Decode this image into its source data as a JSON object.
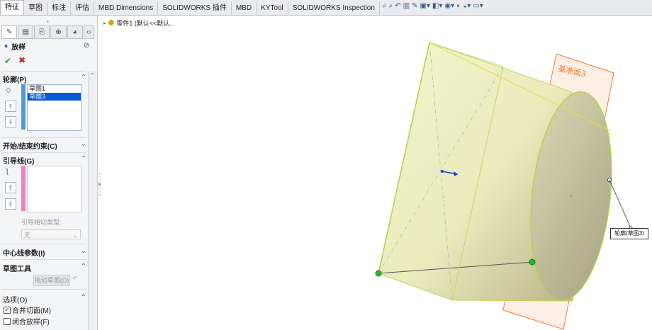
{
  "tabs": [
    "特征",
    "草图",
    "标注",
    "评估",
    "MBD Dimensions",
    "SOLIDWORKS 插件",
    "MBD",
    "KYTool",
    "SOLIDWORKS Inspection"
  ],
  "panel": {
    "feature_title": "放样",
    "sections": {
      "profiles": {
        "label": "轮廓(P)",
        "items": [
          "草图1",
          "草图3"
        ],
        "selected": "草图3"
      },
      "start_end": {
        "label": "开始/结束约束(C)"
      },
      "guides": {
        "label": "引导线(G)",
        "tangency_label": "引导相切类型:",
        "tangency_value": "无"
      },
      "centerline": {
        "label": "中心线参数(I)"
      },
      "sketch_tools": {
        "label": "草图工具",
        "drag_button": "拖动草图(D)"
      },
      "options": {
        "label": "选项(O)",
        "merge_label": "合并切面(M)",
        "merge_checked": true,
        "close_label": "闭合放样(F)",
        "close_checked": false
      }
    }
  },
  "tree": {
    "part_label": "零件1 (默认<<默认..."
  },
  "viewport": {
    "plane_label": "基准面3",
    "callout_label": "轮廓(草图3)"
  }
}
